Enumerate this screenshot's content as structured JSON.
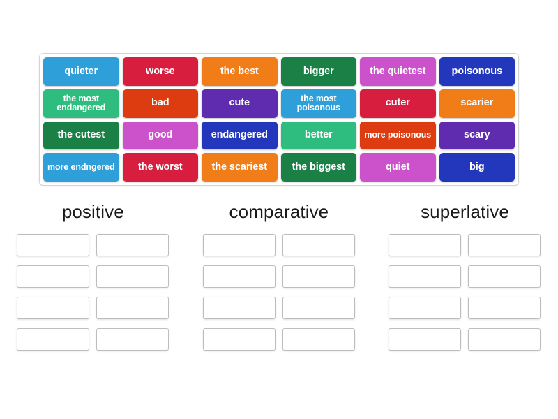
{
  "word_bank": {
    "name": "word-bank",
    "tiles": [
      {
        "label": "quieter",
        "color": "#2e9fd8"
      },
      {
        "label": "worse",
        "color": "#d81e3f"
      },
      {
        "label": "the best",
        "color": "#f07d18"
      },
      {
        "label": "bigger",
        "color": "#1b8046"
      },
      {
        "label": "the quietest",
        "color": "#cc52cc"
      },
      {
        "label": "poisonous",
        "color": "#2237bb"
      },
      {
        "label": "the most endangered",
        "color": "#2fbd7f"
      },
      {
        "label": "bad",
        "color": "#dd3c11"
      },
      {
        "label": "cute",
        "color": "#5f2cb0"
      },
      {
        "label": "the most poisonous",
        "color": "#2e9fd8"
      },
      {
        "label": "cuter",
        "color": "#d81e3f"
      },
      {
        "label": "scarier",
        "color": "#f07d18"
      },
      {
        "label": "the cutest",
        "color": "#1b8046"
      },
      {
        "label": "good",
        "color": "#cc52cc"
      },
      {
        "label": "endangered",
        "color": "#2237bb"
      },
      {
        "label": "better",
        "color": "#2fbd7f"
      },
      {
        "label": "more poisonous",
        "color": "#dd3c11"
      },
      {
        "label": "scary",
        "color": "#5f2cb0"
      },
      {
        "label": "more endngered",
        "color": "#2e9fd8"
      },
      {
        "label": "the worst",
        "color": "#d81e3f"
      },
      {
        "label": "the scariest",
        "color": "#f07d18"
      },
      {
        "label": "the biggest",
        "color": "#1b8046"
      },
      {
        "label": "quiet",
        "color": "#cc52cc"
      },
      {
        "label": "big",
        "color": "#2237bb"
      }
    ]
  },
  "categories": [
    {
      "title": "positive",
      "slots": [
        "",
        "",
        "",
        "",
        "",
        "",
        "",
        ""
      ]
    },
    {
      "title": "comparative",
      "slots": [
        "",
        "",
        "",
        "",
        "",
        "",
        "",
        ""
      ]
    },
    {
      "title": "superlative",
      "slots": [
        "",
        "",
        "",
        "",
        "",
        "",
        "",
        ""
      ]
    }
  ]
}
